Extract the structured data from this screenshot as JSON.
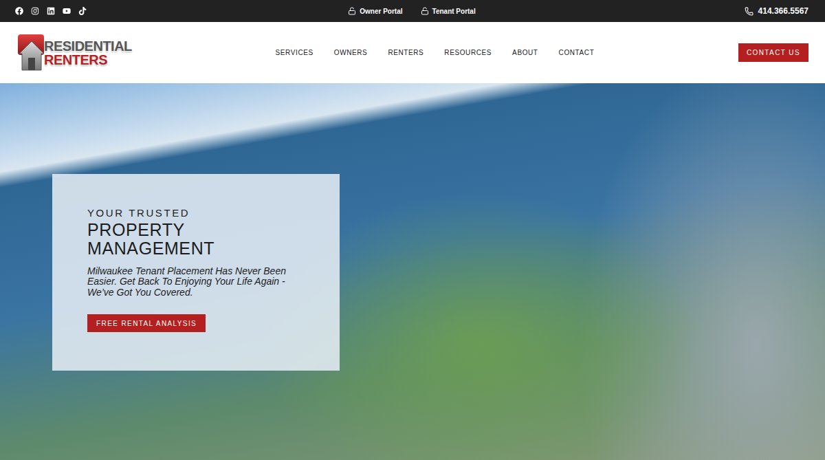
{
  "top_bar": {
    "portals": [
      "Owner Portal",
      "Tenant Portal"
    ],
    "phone": "414.366.5567"
  },
  "logo": {
    "line1": "RESIDENTIAL",
    "line2": "RENTERS"
  },
  "nav": [
    {
      "label": "SERVICES"
    },
    {
      "label": "OWNERS"
    },
    {
      "label": "RENTERS"
    },
    {
      "label": "RESOURCES"
    },
    {
      "label": "ABOUT"
    },
    {
      "label": "CONTACT"
    }
  ],
  "header_button": "CONTACT US",
  "hero": {
    "eyebrow": "YOUR TRUSTED",
    "title": "PROPERTY MANAGEMENT",
    "subtitle": "Milwaukee Tenant Placement Has Never Been Easier. Get Back To Enjoying Your Life Again - We’ve Got You Covered.",
    "button": "FREE RENTAL ANALYSIS"
  }
}
